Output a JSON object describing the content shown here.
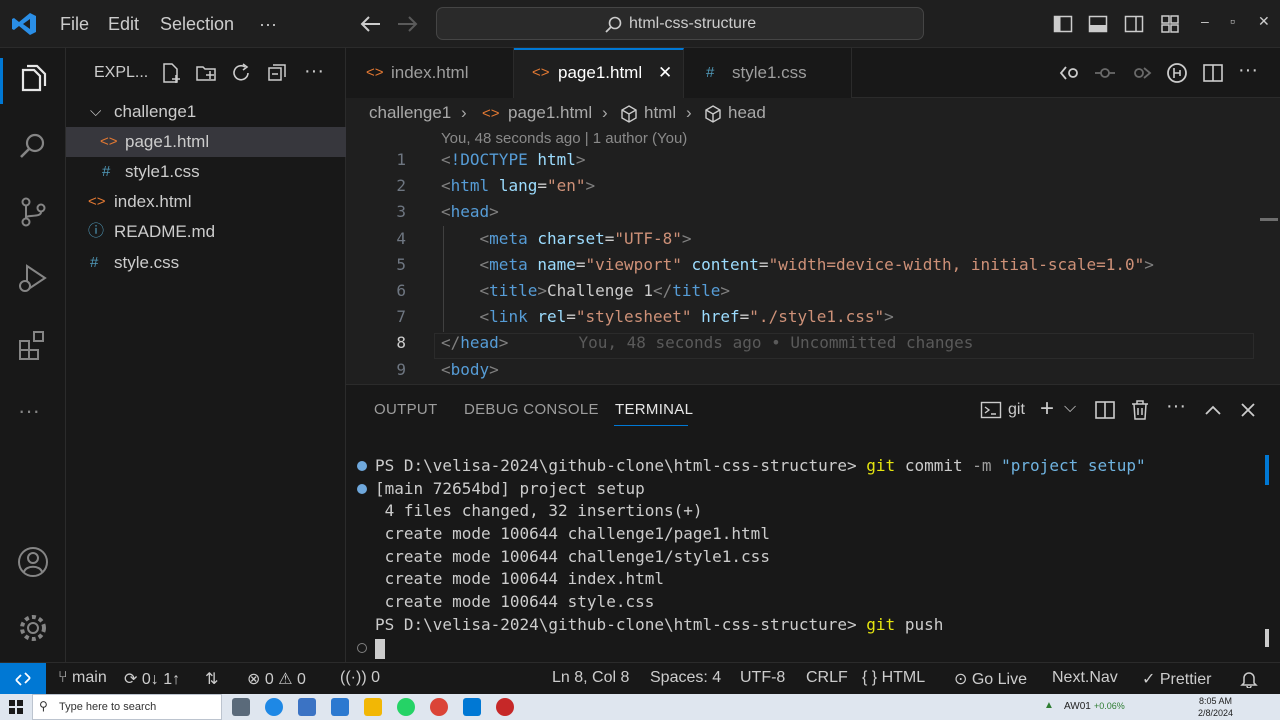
{
  "titlebar": {
    "menu": [
      "File",
      "Edit",
      "Selection",
      "···"
    ],
    "search_text": "html-css-structure"
  },
  "sidebar": {
    "header": "EXPL...",
    "tree": [
      {
        "label": "challenge1",
        "icon": "chevron-down"
      },
      {
        "label": "page1.html",
        "icon": "html",
        "selected": true
      },
      {
        "label": "style1.css",
        "icon": "css"
      },
      {
        "label": "index.html",
        "icon": "html"
      },
      {
        "label": "README.md",
        "icon": "info"
      },
      {
        "label": "style.css",
        "icon": "css"
      }
    ]
  },
  "tabs": [
    {
      "label": "index.html",
      "icon": "<>"
    },
    {
      "label": "page1.html",
      "icon": "<>",
      "active": true
    },
    {
      "label": "style1.css",
      "icon": "#"
    }
  ],
  "breadcrumb": [
    "challenge1",
    "page1.html",
    "html",
    "head"
  ],
  "editor": {
    "blame_header": "You, 48 seconds ago | 1 author (You)",
    "line_numbers": [
      "1",
      "2",
      "3",
      "4",
      "5",
      "6",
      "7",
      "8",
      "9"
    ],
    "current_line": "8",
    "inline_blame": "You, 48 seconds ago • Uncommitted changes",
    "lines": [
      [
        [
          "tg",
          "<"
        ],
        [
          "tn",
          "!DOCTYPE"
        ],
        [
          "tx",
          " "
        ],
        [
          "an",
          "html"
        ],
        [
          "tg",
          ">"
        ]
      ],
      [
        [
          "tg",
          "<"
        ],
        [
          "tn",
          "html"
        ],
        [
          "tx",
          " "
        ],
        [
          "an",
          "lang"
        ],
        [
          "tx",
          "="
        ],
        [
          "av",
          "\"en\""
        ],
        [
          "tg",
          ">"
        ]
      ],
      [
        [
          "tg",
          "<"
        ],
        [
          "tn",
          "head"
        ],
        [
          "tg",
          ">"
        ]
      ],
      [
        [
          "tx",
          "    "
        ],
        [
          "tg",
          "<"
        ],
        [
          "tn",
          "meta"
        ],
        [
          "tx",
          " "
        ],
        [
          "an",
          "charset"
        ],
        [
          "tx",
          "="
        ],
        [
          "av",
          "\"UTF-8\""
        ],
        [
          "tg",
          ">"
        ]
      ],
      [
        [
          "tx",
          "    "
        ],
        [
          "tg",
          "<"
        ],
        [
          "tn",
          "meta"
        ],
        [
          "tx",
          " "
        ],
        [
          "an",
          "name"
        ],
        [
          "tx",
          "="
        ],
        [
          "av",
          "\"viewport\""
        ],
        [
          "tx",
          " "
        ],
        [
          "an",
          "content"
        ],
        [
          "tx",
          "="
        ],
        [
          "av",
          "\"width=device-width, initial-scale=1.0\""
        ],
        [
          "tg",
          ">"
        ]
      ],
      [
        [
          "tx",
          "    "
        ],
        [
          "tg",
          "<"
        ],
        [
          "tn",
          "title"
        ],
        [
          "tg",
          ">"
        ],
        [
          "tx",
          "Challenge 1"
        ],
        [
          "tg",
          "</"
        ],
        [
          "tn",
          "title"
        ],
        [
          "tg",
          ">"
        ]
      ],
      [
        [
          "tx",
          "    "
        ],
        [
          "tg",
          "<"
        ],
        [
          "tn",
          "link"
        ],
        [
          "tx",
          " "
        ],
        [
          "an",
          "rel"
        ],
        [
          "tx",
          "="
        ],
        [
          "av",
          "\"stylesheet\""
        ],
        [
          "tx",
          " "
        ],
        [
          "an",
          "href"
        ],
        [
          "tx",
          "="
        ],
        [
          "av",
          "\"./style1.css\""
        ],
        [
          "tg",
          ">"
        ]
      ],
      [
        [
          "tg",
          "</"
        ],
        [
          "tn",
          "head"
        ],
        [
          "tg",
          ">"
        ]
      ],
      [
        [
          "tg",
          "<"
        ],
        [
          "tn",
          "body"
        ],
        [
          "tg",
          ">"
        ]
      ]
    ]
  },
  "panel": {
    "tabs": [
      "OUTPUT",
      "DEBUG CONSOLE",
      "TERMINAL"
    ],
    "active_tab": "TERMINAL",
    "shell_label": "git"
  },
  "terminal": {
    "prompt": "PS D:\\velisa-2024\\github-clone\\html-css-structure> ",
    "cmd1_git": "git",
    "cmd1_sub": " commit ",
    "cmd1_flag": "-m",
    "cmd1_msg": " \"project setup\"",
    "out": [
      "[main 72654bd] project setup",
      " 4 files changed, 32 insertions(+)",
      " create mode 100644 challenge1/page1.html",
      " create mode 100644 challenge1/style1.css",
      " create mode 100644 index.html",
      " create mode 100644 style.css"
    ],
    "cmd2_git": "git",
    "cmd2_sub": " push"
  },
  "statusbar": {
    "branch": "main",
    "sync": "0↓ 1↑",
    "errors": "0",
    "warnings": "0",
    "ports": "0",
    "position": "Ln 8, Col 8",
    "spaces": "Spaces: 4",
    "encoding": "UTF-8",
    "eol": "CRLF",
    "language": "HTML",
    "golive": "Go Live",
    "nextnav": "Next.Nav",
    "prettier": "Prettier"
  },
  "taskbar": {
    "search_placeholder": "Type here to search",
    "stock": "AW01",
    "stock_change": "+0.06%",
    "time": "8:05 AM",
    "date": "2/8/2024"
  },
  "colors": {
    "accent": "#0078d4",
    "editor_bg": "#1f1f1f",
    "sidebar_bg": "#181818"
  }
}
